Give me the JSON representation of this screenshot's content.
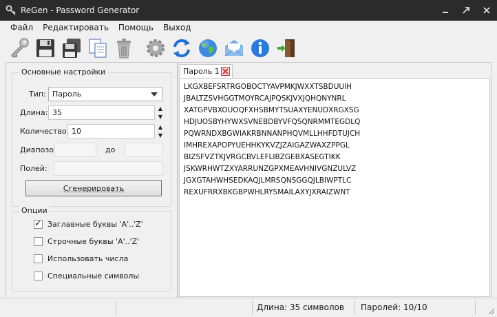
{
  "window": {
    "title": "ReGen - Password Generator"
  },
  "menu": [
    "Файл",
    "Редактировать",
    "Помощь",
    "Выход"
  ],
  "toolbar": [
    "key-icon",
    "save-icon",
    "save-all-icon",
    "copy-icon",
    "trash-icon",
    "settings-icon",
    "refresh-icon",
    "globe-icon",
    "mail-icon",
    "info-icon",
    "exit-door-icon"
  ],
  "settings": {
    "legend": "Основные настройки",
    "type_label": "Тип:",
    "type_value": "Пароль",
    "length_label": "Длина:",
    "length_value": "35",
    "count_label": "Количество:",
    "count_value": "10",
    "range_label": "Диапозон:",
    "range_to": "до",
    "fields_label": "Полей:",
    "generate_button": "Сгенерировать"
  },
  "options": {
    "legend": "Опции",
    "items": [
      {
        "label": "Заглавные буквы 'A'..'Z'",
        "checked": true
      },
      {
        "label": "Строчные буквы 'A'..'Z'",
        "checked": false
      },
      {
        "label": "Использовать числа",
        "checked": false
      },
      {
        "label": "Специальные символы",
        "checked": false
      }
    ]
  },
  "tab": {
    "label": "Пароль 1"
  },
  "passwords": [
    "LKGXBEFSRTRGOBOCTYAVPMKJWXXTSBDUUIH",
    "JBALTZSVHGGTMOYRCAJPQSKJVXJQHQNYNRL",
    "XATGPVBXOUOQFXHSBMYTSUAXYENUDXRGXSG",
    "HDJUOSBYHYWXSVNEBDBYVFQSQNRMMTEGDLQ",
    "PQWRNDXBGWIAKRBNNANPHQVMLLHHFDTUJCH",
    "IMHREXAPOPYUEHHKYKVZJZAIGAZWAXZPPGL",
    "BIZSFVZTKJVRGCBVLEFLIBZGEBXASEGTIKK",
    "JSKWRHWTZXYARRUNZGPXMEAVHNIVGNZULVZ",
    "JGXGTAHWHSEDKAQJLMRSQNSGGQJLBIWPTLC",
    "REXUFRRXBKGBPWHLRYSMAILAXYJXRAIZWNT"
  ],
  "status": {
    "length": "Длина: 35 символов",
    "count": "Паролей: 10/10"
  }
}
